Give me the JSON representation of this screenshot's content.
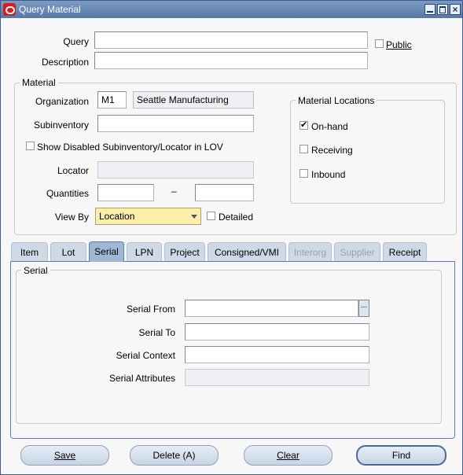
{
  "window": {
    "title": "Query Material"
  },
  "query": {
    "label": "Query",
    "value": "",
    "public_label": "Public",
    "public_checked": false
  },
  "description": {
    "label": "Description",
    "value": ""
  },
  "material": {
    "group_title": "Material",
    "organization": {
      "label": "Organization",
      "code": "M1",
      "name": "Seattle Manufacturing"
    },
    "subinventory": {
      "label": "Subinventory",
      "value": ""
    },
    "show_disabled": {
      "label": "Show Disabled Subinventory/Locator in LOV",
      "checked": false
    },
    "locator": {
      "label": "Locator",
      "value": ""
    },
    "quantities": {
      "label": "Quantities",
      "from": "",
      "separator": "–",
      "to": ""
    },
    "view_by": {
      "label": "View By",
      "value": "Location",
      "detailed_label": "Detailed",
      "detailed_checked": false
    }
  },
  "material_locations": {
    "group_title": "Material Locations",
    "onhand": {
      "label": "On-hand",
      "checked": true
    },
    "receiving": {
      "label": "Receiving",
      "checked": false
    },
    "inbound": {
      "label": "Inbound",
      "checked": false
    }
  },
  "tabs": [
    {
      "label": "Item",
      "state": "normal"
    },
    {
      "label": "Lot",
      "state": "normal"
    },
    {
      "label": "Serial",
      "state": "active"
    },
    {
      "label": "LPN",
      "state": "normal"
    },
    {
      "label": "Project",
      "state": "normal"
    },
    {
      "label": "Consigned/VMI",
      "state": "normal"
    },
    {
      "label": "Interorg",
      "state": "disabled"
    },
    {
      "label": "Supplier",
      "state": "disabled"
    },
    {
      "label": "Receipt",
      "state": "normal"
    }
  ],
  "serial": {
    "group_title": "Serial",
    "from": {
      "label": "Serial From",
      "value": "",
      "lov": "..."
    },
    "to": {
      "label": "Serial To",
      "value": ""
    },
    "context": {
      "label": "Serial Context",
      "value": ""
    },
    "attributes": {
      "label": "Serial Attributes",
      "value": ""
    }
  },
  "buttons": {
    "save": "Save",
    "delete": "Delete (A)",
    "clear": "Clear",
    "find": "Find"
  },
  "colors": {
    "title_bar": "#5578a8",
    "active_tab": "#9fb6d4",
    "lov_field": "#fbeea8",
    "oracle_logo": "#d21f1f"
  }
}
